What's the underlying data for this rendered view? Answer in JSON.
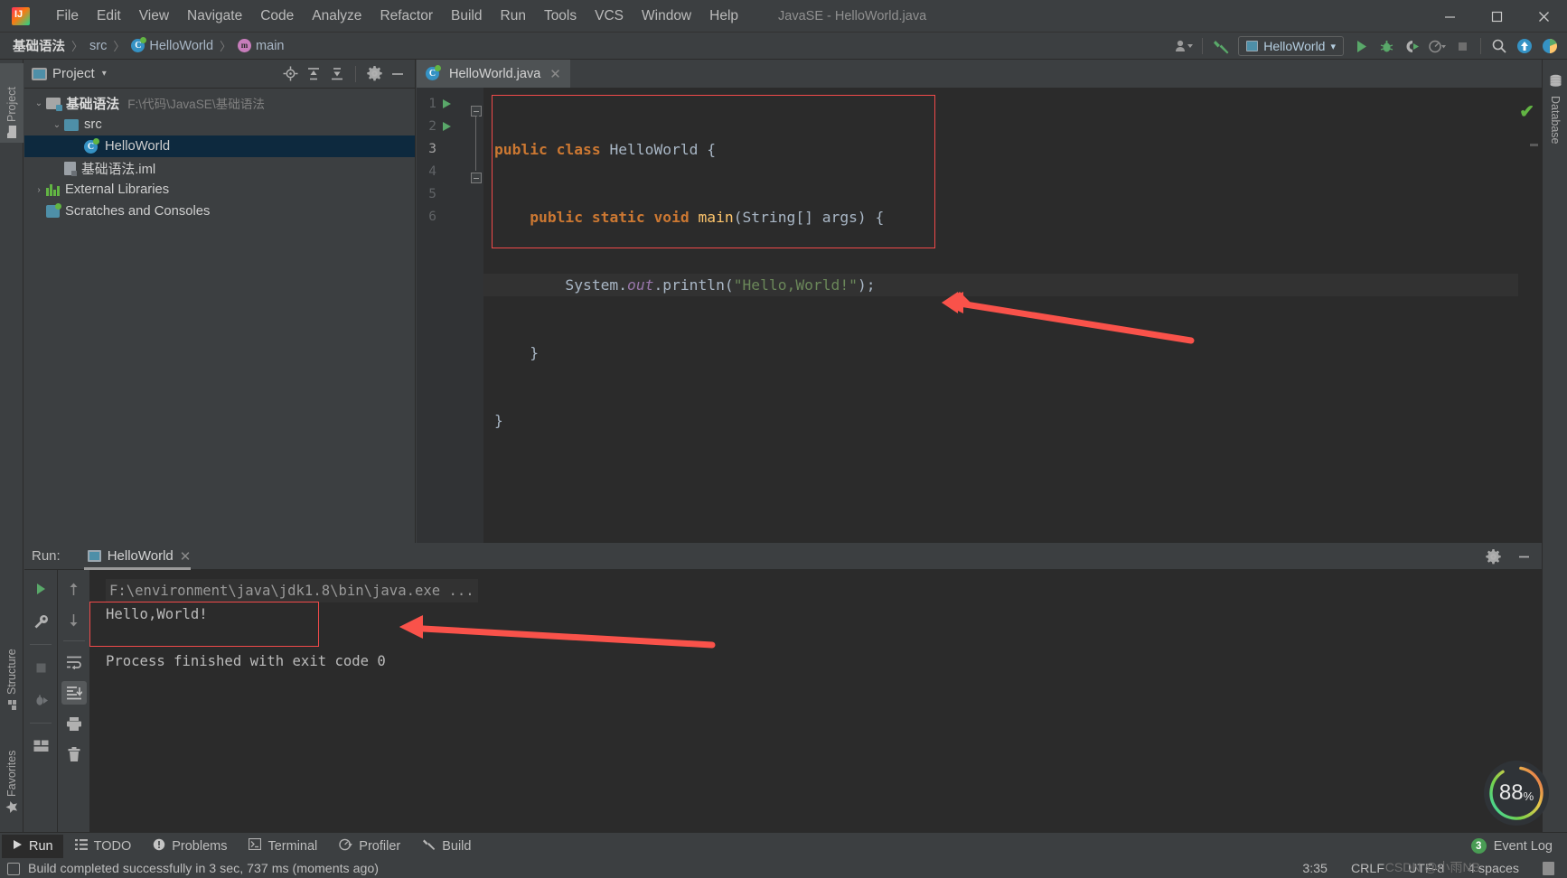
{
  "app": {
    "window_title": "JavaSE - HelloWorld.java",
    "logo_letters": "IJ"
  },
  "menu": {
    "items": [
      {
        "label": "File"
      },
      {
        "label": "Edit"
      },
      {
        "label": "View"
      },
      {
        "label": "Navigate"
      },
      {
        "label": "Code"
      },
      {
        "label": "Analyze"
      },
      {
        "label": "Refactor"
      },
      {
        "label": "Build"
      },
      {
        "label": "Run"
      },
      {
        "label": "Tools"
      },
      {
        "label": "VCS"
      },
      {
        "label": "Window"
      },
      {
        "label": "Help"
      }
    ]
  },
  "window_controls": {
    "minimize": "–",
    "maximize": "☐",
    "close": "✕"
  },
  "breadcrumb": {
    "items": [
      {
        "label": "基础语法",
        "icon": "none"
      },
      {
        "label": "src",
        "icon": "none"
      },
      {
        "label": "HelloWorld",
        "icon": "class-icon"
      },
      {
        "label": "main",
        "icon": "method-icon"
      }
    ],
    "separator": "〉"
  },
  "toolbar": {
    "profile_icon": "user-profile-icon",
    "build_icon": "hammer-icon",
    "run_config": {
      "label": "HelloWorld",
      "caret": "▾"
    },
    "run_icon": "run-icon",
    "debug_icon": "debug-bug-icon",
    "run_coverage_icon": "run-with-coverage-icon",
    "profile_dropdown_icon": "profiler-icon",
    "stop_icon": "stop-icon",
    "search_icon": "search-everywhere-icon",
    "update_icon": "update-project-icon",
    "ide_icon": "ide-and-project-settings-icon"
  },
  "left_stripe": {
    "tabs": [
      {
        "label": "Project",
        "icon": "folder-icon",
        "active": true
      },
      {
        "label": "Structure",
        "icon": "structure-icon",
        "active": false
      },
      {
        "label": "Favorites",
        "icon": "star-icon",
        "active": false
      }
    ]
  },
  "right_stripe": {
    "tabs": [
      {
        "label": "Database",
        "icon": "database-icon"
      }
    ]
  },
  "project_panel": {
    "title": "Project",
    "caret": "▾",
    "header_icons": [
      "locate-icon",
      "expand-all-icon",
      "collapse-all-icon",
      "gear-icon",
      "hide-icon"
    ],
    "tree": [
      {
        "indent": 0,
        "arrow": "⌄",
        "icon": "module-folder-icon",
        "label": "基础语法",
        "bold": true,
        "path": "F:\\代码\\JavaSE\\基础语法",
        "selected": false
      },
      {
        "indent": 1,
        "arrow": "⌄",
        "icon": "source-folder-icon",
        "label": "src",
        "bold": false,
        "path": "",
        "selected": false
      },
      {
        "indent": 2,
        "arrow": "",
        "icon": "class-icon",
        "label": "HelloWorld",
        "bold": false,
        "path": "",
        "selected": true
      },
      {
        "indent": 1,
        "arrow": "",
        "icon": "iml-file-icon",
        "label": "基础语法.iml",
        "bold": false,
        "path": "",
        "selected": false
      },
      {
        "indent": 0,
        "arrow": "›",
        "icon": "library-icon",
        "label": "External Libraries",
        "bold": false,
        "path": "",
        "selected": false
      },
      {
        "indent": 0,
        "arrow": "",
        "icon": "scratches-icon",
        "label": "Scratches and Consoles",
        "bold": false,
        "path": "",
        "selected": false
      }
    ]
  },
  "editor": {
    "tab": {
      "label": "HelloWorld.java",
      "icon": "class-icon",
      "close": "✕"
    },
    "line_numbers": [
      "1",
      "2",
      "3",
      "4",
      "5",
      "6"
    ],
    "gutter_run_lines": [
      1,
      2
    ],
    "code_lines": [
      {
        "n": 1,
        "segments": [
          {
            "t": "public ",
            "c": "kw"
          },
          {
            "t": "class ",
            "c": "kw"
          },
          {
            "t": "HelloWorld",
            "c": "cls"
          },
          {
            "t": " {",
            "c": "punc"
          }
        ]
      },
      {
        "n": 2,
        "segments": [
          {
            "t": "    ",
            "c": "punc"
          },
          {
            "t": "public ",
            "c": "kw"
          },
          {
            "t": "static ",
            "c": "kw"
          },
          {
            "t": "void ",
            "c": "kw"
          },
          {
            "t": "main",
            "c": "mth"
          },
          {
            "t": "(String[] args) {",
            "c": "punc"
          }
        ]
      },
      {
        "n": 3,
        "segments": [
          {
            "t": "        System.",
            "c": "punc"
          },
          {
            "t": "out",
            "c": "fld"
          },
          {
            "t": ".println(",
            "c": "punc"
          },
          {
            "t": "\"Hello,World!\"",
            "c": "str"
          },
          {
            "t": ");",
            "c": "punc"
          }
        ]
      },
      {
        "n": 4,
        "segments": [
          {
            "t": "    }",
            "c": "punc"
          }
        ]
      },
      {
        "n": 5,
        "segments": [
          {
            "t": "}",
            "c": "punc"
          }
        ]
      },
      {
        "n": 6,
        "segments": [
          {
            "t": "",
            "c": "punc"
          }
        ]
      }
    ],
    "inspection_status": "✔"
  },
  "run_panel": {
    "label": "Run:",
    "tab": {
      "label": "HelloWorld",
      "close": "✕",
      "icon": "run-config-icon"
    },
    "header_icons": [
      "gear-icon",
      "hide-icon"
    ],
    "toolbar_left": [
      "rerun-icon",
      "wrench-icon",
      "stop-icon",
      "rerun-failed-icon",
      "layout-icon"
    ],
    "toolbar_right": [
      "up-arrow-icon",
      "down-arrow-icon",
      "soft-wrap-icon",
      "scroll-to-end-icon",
      "print-icon",
      "trash-icon"
    ],
    "console_lines": [
      {
        "text": "F:\\environment\\java\\jdk1.8\\bin\\java.exe ...",
        "style": "dim"
      },
      {
        "text": "Hello,World!",
        "style": "normal"
      },
      {
        "text": "",
        "style": "normal"
      },
      {
        "text": "Process finished with exit code 0",
        "style": "normal"
      }
    ]
  },
  "bottom_toolbar": {
    "items": [
      {
        "label": "Run",
        "icon": "run-icon",
        "active": true
      },
      {
        "label": "TODO",
        "icon": "todo-list-icon",
        "active": false
      },
      {
        "label": "Problems",
        "icon": "problems-icon",
        "active": false
      },
      {
        "label": "Terminal",
        "icon": "terminal-icon",
        "active": false
      },
      {
        "label": "Profiler",
        "icon": "profiler-icon",
        "active": false
      },
      {
        "label": "Build",
        "icon": "hammer-icon",
        "active": false
      }
    ],
    "event_log": {
      "label": "Event Log",
      "count": "3"
    }
  },
  "status_bar": {
    "message": "Build completed successfully in 3 sec, 737 ms (moments ago)",
    "caret_position": "3:35",
    "line_separator": "CRLF",
    "encoding": "UTF-8",
    "indent": "4 spaces",
    "lock_icon": "lock-icon"
  },
  "progress_donut": {
    "value": "88",
    "unit": "%"
  },
  "watermark": "CSDN @小雨NB",
  "colors": {
    "accent_green": "#62b543",
    "annotation_red": "#f04a4a",
    "selection_blue": "#0d293e",
    "panel_bg": "#3c3f41",
    "editor_bg": "#2b2b2b",
    "keyword_orange": "#cc7832",
    "string_green": "#6a8759",
    "method_yellow": "#ffc66d",
    "field_purple": "#9876aa"
  }
}
